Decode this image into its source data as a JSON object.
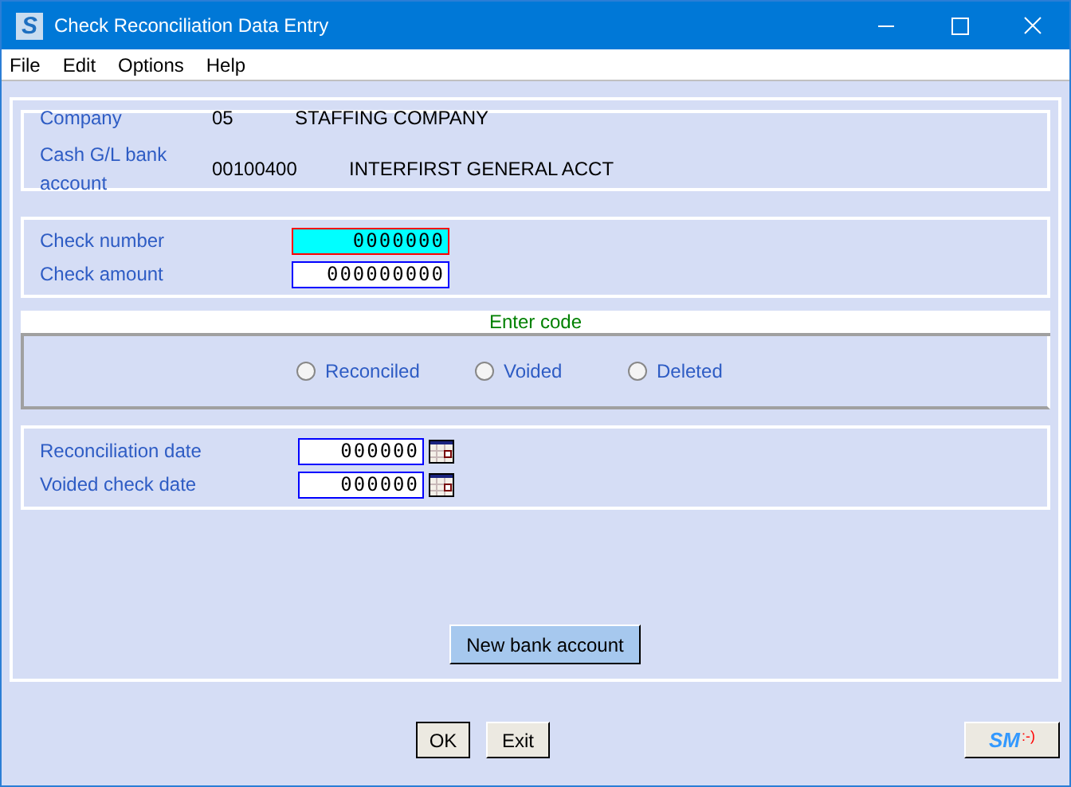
{
  "window": {
    "icon_letter": "S",
    "title": "Check Reconciliation Data Entry"
  },
  "menu": [
    "File",
    "Edit",
    "Options",
    "Help"
  ],
  "company": {
    "label": "Company",
    "code": "05",
    "name": "STAFFING COMPANY"
  },
  "bank_account": {
    "label": "Cash G/L bank account",
    "code": "00100400",
    "name": "INTERFIRST GENERAL ACCT"
  },
  "check_fields": [
    {
      "label": "Check number",
      "value": "0000000",
      "focused": true
    },
    {
      "label": "Check amount",
      "value": "000000000",
      "focused": false
    }
  ],
  "code_header": "Enter code",
  "codes": [
    {
      "label": "Reconciled",
      "selected": false
    },
    {
      "label": "Voided",
      "selected": false
    },
    {
      "label": "Deleted",
      "selected": false
    }
  ],
  "date_fields": [
    {
      "label": "Reconciliation date",
      "value": "000000"
    },
    {
      "label": "Voided check date",
      "value": "000000"
    }
  ],
  "new_bank_button": "New bank account",
  "buttons": [
    "OK",
    "Exit"
  ],
  "logo": {
    "letters": "SM",
    "smiley": ":-)"
  }
}
